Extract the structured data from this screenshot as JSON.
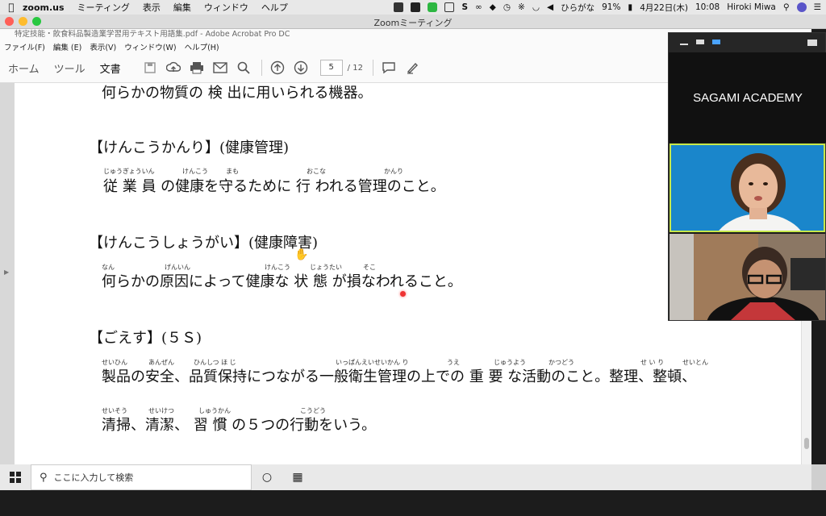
{
  "mac_menubar": {
    "app": "zoom.us",
    "items": [
      "ミーティング",
      "表示",
      "編集",
      "ウィンドウ",
      "ヘルプ"
    ],
    "input_mode": "ひらがな",
    "battery": "91%",
    "date": "4月22日(木)",
    "time": "10:08",
    "user": "Hiroki Miwa"
  },
  "zoom_window": {
    "title": "Zoomミーティング"
  },
  "acrobat": {
    "window_title": "特定技能・飲食料品製造業学習用テキスト用語集.pdf - Adobe Acrobat Pro DC",
    "menu": [
      "ファイル(F)",
      "編集 (E)",
      "表示(V)",
      "ウィンドウ(W)",
      "ヘルプ(H)"
    ],
    "tabs": [
      "ホーム",
      "ツール",
      "文書"
    ],
    "current_page": "5",
    "total_pages": "/ 12"
  },
  "document": {
    "line0": "何らかの物質の 検 出に用いられる機器。",
    "heading1": "【けんこうかんり】(健康管理)",
    "ruby1": [
      "じゅうぎょういん",
      "けんこう",
      "まも",
      "おこな",
      "かんり"
    ],
    "body1": "従 業 員 の健康を守るために 行 われる管理のこと。",
    "heading2": "【けんこうしょうがい】(健康障害)",
    "ruby2": [
      "なん",
      "げんいん",
      "けんこう",
      "じょうたい",
      "そこ"
    ],
    "body2": "何らかの原因によって健康な 状 態 が損なわれること。",
    "heading3": "【ごえす】(５Ｓ)",
    "ruby3": [
      "せいひん",
      "あんぜん",
      "ひんしつ ほ じ",
      "いっぱんえいせいかん り",
      "うえ",
      "じゅうよう",
      "かつどう",
      "せ い り",
      "せいとん"
    ],
    "body3": "製品の安全、品質保持につながる一般衛生管理の上での 重 要 な活動のこと。整理、整頓、",
    "ruby4": [
      "せいそう",
      "せいけつ",
      "しゅうかん",
      "こうどう"
    ],
    "body4": "清掃、清潔、 習 慣 の５つの行動をいう。"
  },
  "zoom_panel": {
    "host_name": "SAGAMI ACADEMY"
  },
  "taskbar": {
    "search_placeholder": "ここに入力して検索"
  }
}
